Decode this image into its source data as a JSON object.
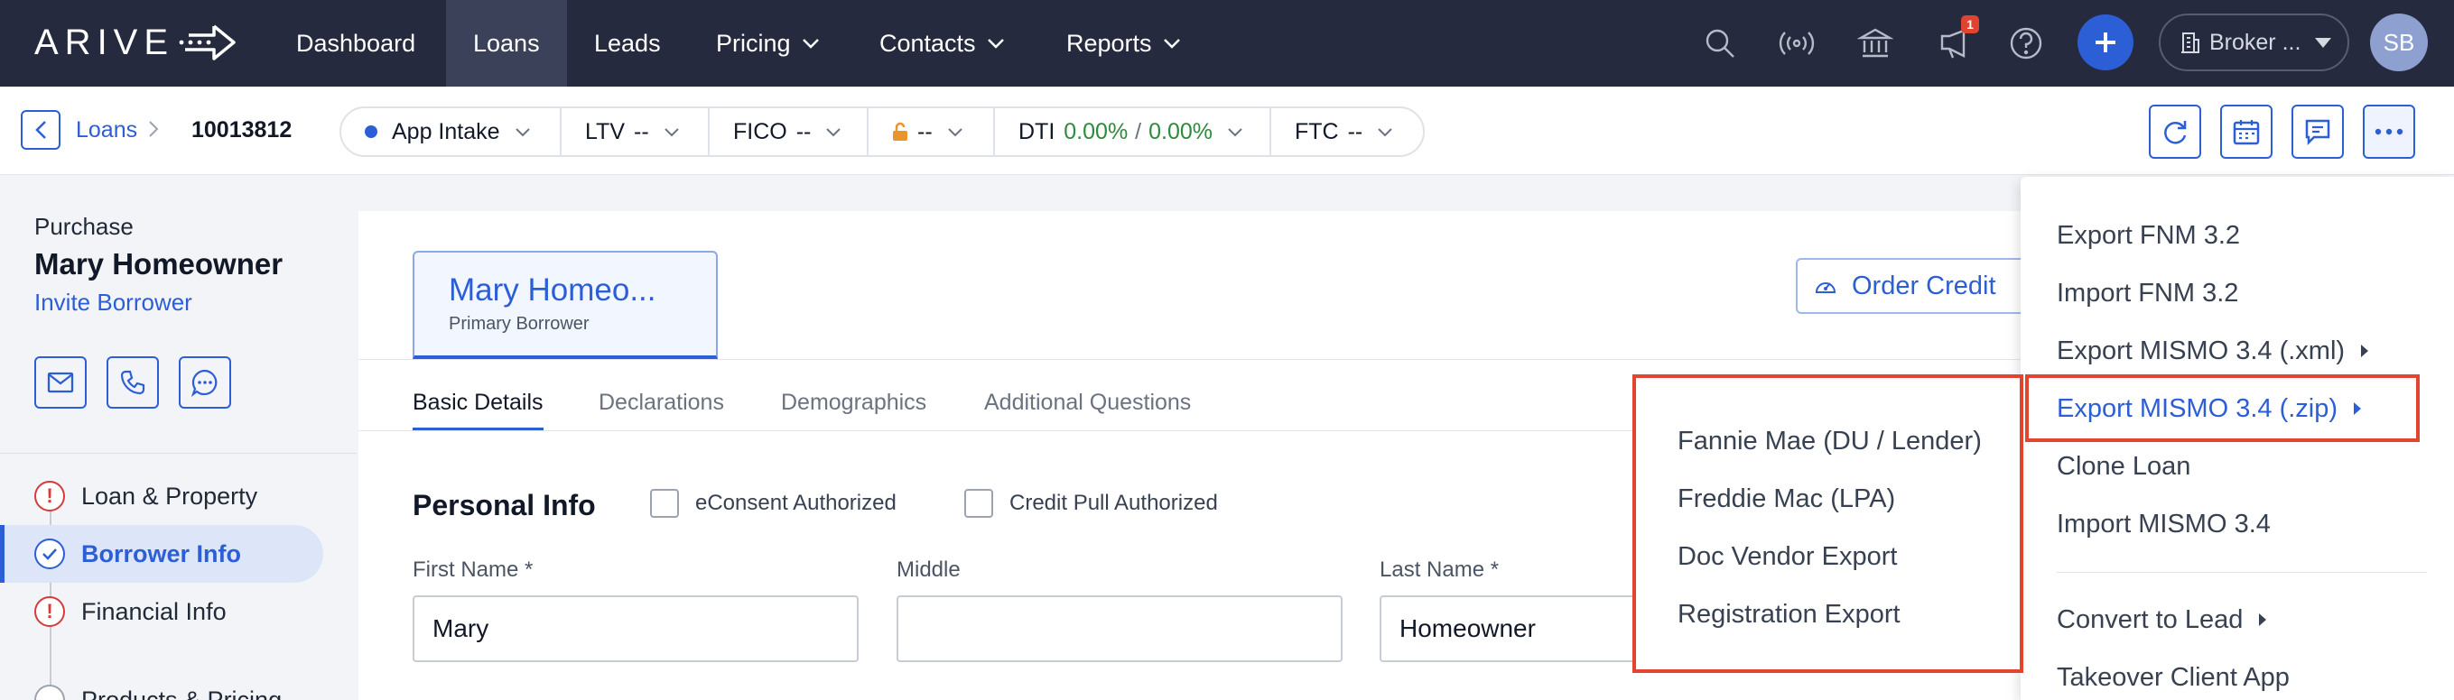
{
  "brand": {
    "logo_text": "ARIVE"
  },
  "nav": {
    "items": [
      {
        "label": "Dashboard"
      },
      {
        "label": "Loans"
      },
      {
        "label": "Leads"
      },
      {
        "label": "Pricing"
      },
      {
        "label": "Contacts"
      },
      {
        "label": "Reports"
      }
    ],
    "notification_count": "1",
    "broker_label": "Broker ...",
    "user_initials": "SB"
  },
  "breadcrumb": {
    "parent": "Loans",
    "current": "10013812"
  },
  "metrics": {
    "status": "App Intake",
    "ltv_label": "LTV",
    "ltv_value": "--",
    "fico_label": "FICO",
    "fico_value": "--",
    "lock_value": "--",
    "dti_label": "DTI",
    "dti_front": "0.00%",
    "dti_sep": "/",
    "dti_back": "0.00%",
    "ftc_label": "FTC",
    "ftc_value": "--"
  },
  "sidebar": {
    "loan_type": "Purchase",
    "borrower_name": "Mary Homeowner",
    "invite_label": "Invite Borrower",
    "items": [
      {
        "label": "Loan & Property"
      },
      {
        "label": "Borrower Info"
      },
      {
        "label": "Financial Info"
      },
      {
        "label": "Products & Pricing"
      }
    ]
  },
  "borrower_tab": {
    "name": "Mary Homeo...",
    "role": "Primary Borrower"
  },
  "order_credit_label": "Order Credit",
  "subtabs": [
    {
      "label": "Basic Details"
    },
    {
      "label": "Declarations"
    },
    {
      "label": "Demographics"
    },
    {
      "label": "Additional Questions"
    }
  ],
  "personal_info": {
    "title": "Personal Info",
    "econsent_label": "eConsent Authorized",
    "credit_pull_label": "Credit Pull Authorized",
    "first_name_label": "First Name *",
    "first_name_value": "Mary",
    "middle_label": "Middle",
    "middle_value": "",
    "last_name_label": "Last Name *",
    "last_name_value": "Homeowner"
  },
  "menu": {
    "items": [
      {
        "label": "Export FNM 3.2"
      },
      {
        "label": "Import FNM 3.2"
      },
      {
        "label": "Export MISMO 3.4 (.xml)"
      },
      {
        "label": "Export MISMO 3.4 (.zip)"
      },
      {
        "label": "Clone Loan"
      },
      {
        "label": "Import MISMO 3.4"
      },
      {
        "label": "Convert to Lead"
      },
      {
        "label": "Takeover Client App"
      }
    ]
  },
  "submenu": {
    "items": [
      {
        "label": "Fannie Mae (DU / Lender)"
      },
      {
        "label": "Freddie Mac (LPA)"
      },
      {
        "label": "Doc Vendor Export"
      },
      {
        "label": "Registration Export"
      }
    ]
  },
  "colors": {
    "accent": "#2c5ed6",
    "nav_bg": "#252a3e",
    "highlight": "#e2442f",
    "success": "#2e8a3c",
    "error": "#d63a3a"
  }
}
